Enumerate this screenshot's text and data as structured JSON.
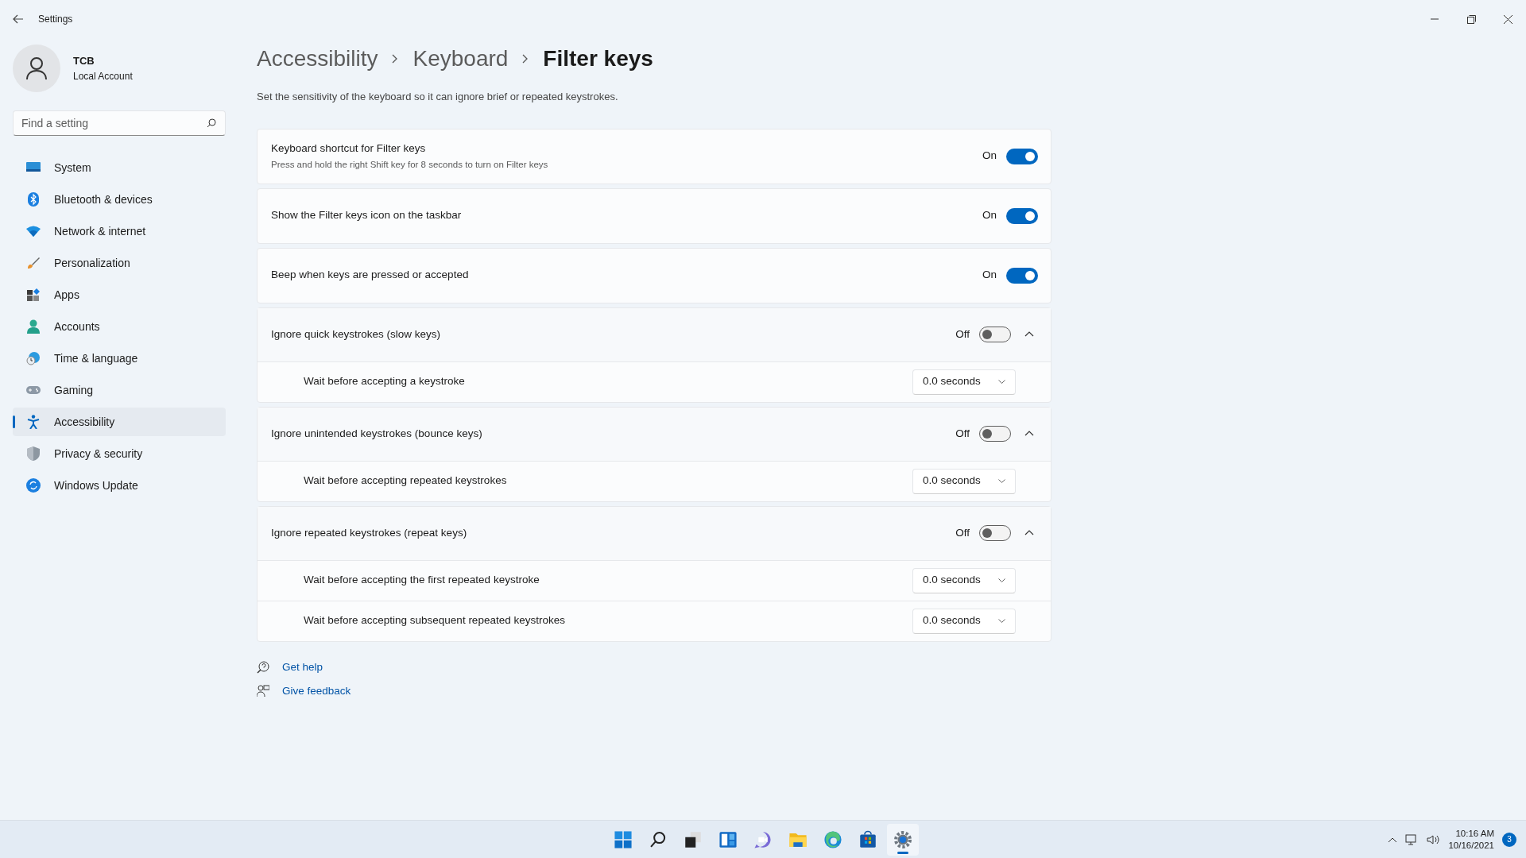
{
  "window": {
    "title": "Settings"
  },
  "account": {
    "name": "TCB",
    "type": "Local Account"
  },
  "search": {
    "placeholder": "Find a setting"
  },
  "sidebar": {
    "items": [
      {
        "label": "System",
        "selected": false
      },
      {
        "label": "Bluetooth & devices",
        "selected": false
      },
      {
        "label": "Network & internet",
        "selected": false
      },
      {
        "label": "Personalization",
        "selected": false
      },
      {
        "label": "Apps",
        "selected": false
      },
      {
        "label": "Accounts",
        "selected": false
      },
      {
        "label": "Time & language",
        "selected": false
      },
      {
        "label": "Gaming",
        "selected": false
      },
      {
        "label": "Accessibility",
        "selected": true
      },
      {
        "label": "Privacy & security",
        "selected": false
      },
      {
        "label": "Windows Update",
        "selected": false
      }
    ]
  },
  "breadcrumb": [
    "Accessibility",
    "Keyboard",
    "Filter keys"
  ],
  "description": "Set the sensitivity of the keyboard so it can ignore brief or repeated keystrokes.",
  "settings": [
    {
      "kind": "toggle",
      "title": "Keyboard shortcut for Filter keys",
      "subtitle": "Press and hold the right Shift key for 8 seconds to turn on Filter keys",
      "state_label": "On",
      "on": true
    },
    {
      "kind": "toggle",
      "title": "Show the Filter keys icon on the taskbar",
      "state_label": "On",
      "on": true
    },
    {
      "kind": "toggle",
      "title": "Beep when keys are pressed or accepted",
      "state_label": "On",
      "on": true
    },
    {
      "kind": "expander",
      "title": "Ignore quick keystrokes (slow keys)",
      "state_label": "Off",
      "on": false,
      "expanded": true,
      "children": [
        {
          "label": "Wait before accepting a keystroke",
          "value": "0.0 seconds"
        }
      ]
    },
    {
      "kind": "expander",
      "title": "Ignore unintended keystrokes (bounce keys)",
      "state_label": "Off",
      "on": false,
      "expanded": true,
      "children": [
        {
          "label": "Wait before accepting repeated keystrokes",
          "value": "0.0 seconds"
        }
      ]
    },
    {
      "kind": "expander",
      "title": "Ignore repeated keystrokes (repeat keys)",
      "state_label": "Off",
      "on": false,
      "expanded": true,
      "children": [
        {
          "label": "Wait before accepting the first repeated keystroke",
          "value": "0.0 seconds"
        },
        {
          "label": "Wait before accepting subsequent repeated keystrokes",
          "value": "0.0 seconds"
        }
      ]
    }
  ],
  "links": [
    "Get help",
    "Give feedback"
  ],
  "taskbar": {
    "apps": [
      {
        "selected": false
      },
      {
        "selected": false
      },
      {
        "selected": false
      },
      {
        "selected": false
      },
      {
        "selected": false
      },
      {
        "selected": false
      },
      {
        "selected": false
      },
      {
        "selected": false
      },
      {
        "selected": true
      }
    ]
  },
  "tray": {
    "time": "10:16 AM",
    "date": "10/16/2021",
    "notifications": "3"
  }
}
